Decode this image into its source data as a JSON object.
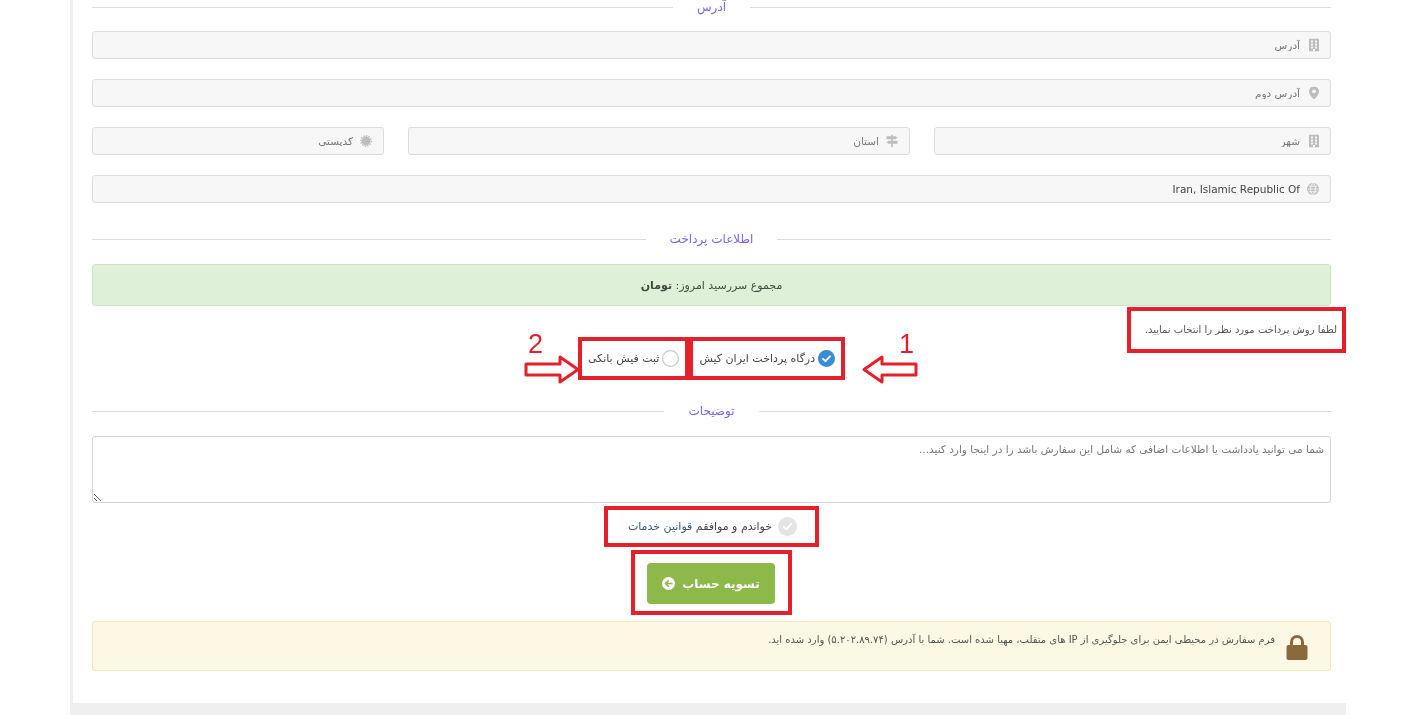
{
  "address_section": {
    "title": "آدرس",
    "rows": [
      [
        {
          "placeholder": "آدرس"
        }
      ],
      [
        {
          "placeholder": "آدرس دوم"
        }
      ],
      [
        {
          "placeholder": "شهر"
        },
        {
          "placeholder": "استان"
        },
        {
          "placeholder": "کدپستی"
        }
      ],
      [
        {
          "value": "Iran, Islamic Republic Of"
        }
      ]
    ]
  },
  "payment_section": {
    "title": "اطلاعات پرداخت",
    "total_due": "مجموع سررسید امروز: **تومان**",
    "hint": {
      "text": "لطفا روش پرداخت مورد نظر را انتخاب نمایید.",
      "highlighted": true
    },
    "methods": [
      {
        "label": "درگاه پرداخت ایران کیش",
        "selected": true,
        "highlighted": true,
        "callout": {
          "number": "1",
          "on_right": true
        }
      },
      {
        "label": "ثبت فیش بانکی",
        "selected": false,
        "highlighted": true,
        "callout": {
          "number": "2",
          "on_right": false
        }
      }
    ]
  },
  "notes_section": {
    "title": "توضیحات",
    "placeholder": "شما می توانید یادداشت یا اطلاعات اضافی که شامل این سفارش باشد را در اینجا وارد کنید..."
  },
  "terms": {
    "text": "خواندم و موافقم",
    "link": "قوانین خدمات",
    "checked": false,
    "highlighted": true
  },
  "submit_button": {
    "label": "تسویه حساب",
    "highlighted": true
  },
  "security_notice": {
    "text": "فرم سفارش در محیطی ایمن برای جلوگیری از IP های متقلب، مهیا شده است. شما با آدرس (۵.۲۰۲.۸۹.۷۴) وارد شده اید."
  }
}
